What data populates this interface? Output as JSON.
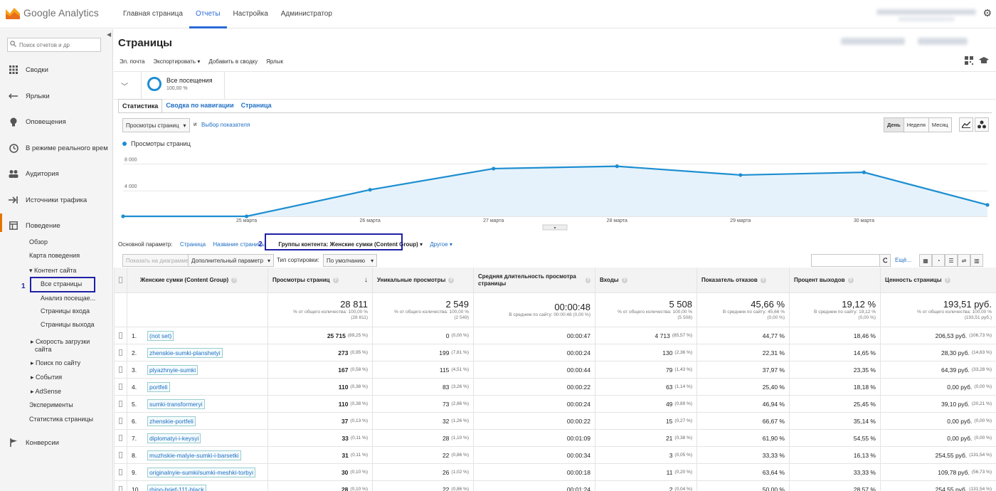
{
  "app": {
    "logo_text": "Google Analytics"
  },
  "topnav": [
    {
      "label": "Главная страница",
      "active": false
    },
    {
      "label": "Отчеты",
      "active": true
    },
    {
      "label": "Настройка",
      "active": false
    },
    {
      "label": "Администратор",
      "active": false
    }
  ],
  "sidebar": {
    "search_placeholder": "Поиск отчетов и др",
    "items": [
      {
        "label": "Сводки",
        "icon": "grid-icon"
      },
      {
        "label": "Ярлыки",
        "icon": "shortcut-icon"
      },
      {
        "label": "Оповещения",
        "icon": "lightbulb-icon"
      },
      {
        "label": "В режиме реального врем",
        "icon": "clock-icon"
      },
      {
        "label": "Аудитория",
        "icon": "people-icon"
      },
      {
        "label": "Источники трафика",
        "icon": "traffic-icon"
      },
      {
        "label": "Поведение",
        "icon": "behavior-icon"
      },
      {
        "label": "Конверсии",
        "icon": "flag-icon"
      }
    ],
    "behavior_sub": {
      "overview": "Обзор",
      "behavior_map": "Карта поведения",
      "content": "▾ Контент сайта",
      "all_pages": "Все страницы",
      "content_drilldown": "Анализ посещае...",
      "landing_pages": "Страницы входа",
      "exit_pages": "Страницы выхода",
      "site_speed": "▸ Скорость загрузки",
      "site_speed_2": "сайта",
      "site_search": "▸ Поиск по сайту",
      "events": "▸ События",
      "adsense": "▸ AdSense",
      "experiments": "Эксперименты",
      "in_page": "Статистика страницы"
    },
    "annotation_1": "1"
  },
  "page": {
    "title": "Страницы",
    "toolbar": {
      "email": "Эл. почта",
      "export": "Экспортировать ▾",
      "add_dashboard": "Добавить в сводку",
      "shortcut": "Ярлык"
    },
    "segment": {
      "name": "Все посещения",
      "pct": "100,00 %"
    },
    "tabs": [
      "Статистика",
      "Сводка по навигации",
      "Страница"
    ],
    "metric_select": "Просмотры страниц",
    "metric_and": "и",
    "metric_compare": "Выбор показателя",
    "periods": [
      "День",
      "Неделя",
      "Месяц"
    ],
    "active_period": "День"
  },
  "chart_data": {
    "type": "area",
    "legend": "Просмотры страниц",
    "color": "#1d8ed1",
    "y_ticks": [
      "8 000",
      "4 000"
    ],
    "ylim": [
      0,
      9000
    ],
    "x_labels": [
      "25 марта",
      "26 марта",
      "27 марта",
      "28 марта",
      "29 марта",
      "30 марта"
    ],
    "points": [
      {
        "x": 0,
        "y": 0
      },
      {
        "x": 1,
        "y": 0
      },
      {
        "x": 2,
        "y": 3950
      },
      {
        "x": 3,
        "y": 7100
      },
      {
        "x": 4,
        "y": 7450
      },
      {
        "x": 5,
        "y": 6150
      },
      {
        "x": 6,
        "y": 6550
      },
      {
        "x": 7,
        "y": 1700
      }
    ]
  },
  "dimensions": {
    "primary_label": "Основной параметр:",
    "page": "Страница",
    "page_title": "Название страницы",
    "content_group": "Группы контента: Женские сумки (Content Group) ▾",
    "other": "Другое ▾",
    "annotation_2": "2"
  },
  "controls": {
    "plot_rows": "Показать на диаграмме",
    "secondary": "Дополнительный параметр",
    "sort_type_label": "Тип сортировки:",
    "sort_default": "По умолчанию",
    "advanced": "Ещё..."
  },
  "table": {
    "headers": [
      "Женские сумки (Content Group)",
      "Просмотры страниц",
      "Уникальные просмотры",
      "Средняя длительность просмотра страницы",
      "Входы",
      "Показатель отказов",
      "Процент выходов",
      "Ценность страницы"
    ],
    "sort_arrow": "↓",
    "totals": [
      {
        "big": "28 811",
        "small1": "% от общего количества: 100,00 %",
        "small2": "(28 811)"
      },
      {
        "big": "2 549",
        "small1": "% от общего количества: 100,00 %",
        "small2": "(2 549)"
      },
      {
        "big": "00:00:48",
        "small1": "В среднем по сайту: 00:00:48 (0,00 %)",
        "small2": ""
      },
      {
        "big": "5 508",
        "small1": "% от общего количества: 100,00 %",
        "small2": "(5 508)"
      },
      {
        "big": "45,66 %",
        "small1": "В среднем по сайту: 45,66 %",
        "small2": "(0,00 %)"
      },
      {
        "big": "19,12 %",
        "small1": "В среднем по сайту: 19,12 %",
        "small2": "(0,00 %)"
      },
      {
        "big": "193,51 руб.",
        "small1": "% от общего количества: 100,00 %",
        "small2": "(193,51 руб.)"
      }
    ],
    "rows": [
      {
        "n": "1.",
        "page": "(not set)",
        "views": "25 715",
        "views_pct": "(89,25 %)",
        "uniq": "0",
        "uniq_pct": "(0,00 %)",
        "dur": "00:00:47",
        "ent": "4 713",
        "ent_pct": "(85,57 %)",
        "bounce": "44,77 %",
        "exit": "18,46 %",
        "value": "206,53 руб.",
        "value_pct": "(106,73 %)"
      },
      {
        "n": "2.",
        "page": "zhenskie-sumki-planshetyi",
        "views": "273",
        "views_pct": "(0,95 %)",
        "uniq": "199",
        "uniq_pct": "(7,81 %)",
        "dur": "00:00:24",
        "ent": "130",
        "ent_pct": "(2,36 %)",
        "bounce": "22,31 %",
        "exit": "14,65 %",
        "value": "28,30 руб.",
        "value_pct": "(14,63 %)"
      },
      {
        "n": "3.",
        "page": "plyazhnyie-sumki",
        "views": "167",
        "views_pct": "(0,58 %)",
        "uniq": "115",
        "uniq_pct": "(4,51 %)",
        "dur": "00:00:44",
        "ent": "79",
        "ent_pct": "(1,43 %)",
        "bounce": "37,97 %",
        "exit": "23,35 %",
        "value": "64,39 руб.",
        "value_pct": "(33,28 %)"
      },
      {
        "n": "4.",
        "page": "portfeli",
        "views": "110",
        "views_pct": "(0,38 %)",
        "uniq": "83",
        "uniq_pct": "(3,26 %)",
        "dur": "00:00:22",
        "ent": "63",
        "ent_pct": "(1,14 %)",
        "bounce": "25,40 %",
        "exit": "18,18 %",
        "value": "0,00 руб.",
        "value_pct": "(0,00 %)"
      },
      {
        "n": "5.",
        "page": "sumki-transformeryi",
        "views": "110",
        "views_pct": "(0,38 %)",
        "uniq": "73",
        "uniq_pct": "(2,86 %)",
        "dur": "00:00:24",
        "ent": "49",
        "ent_pct": "(0,89 %)",
        "bounce": "46,94 %",
        "exit": "25,45 %",
        "value": "39,10 руб.",
        "value_pct": "(20,21 %)"
      },
      {
        "n": "6.",
        "page": "zhenskie-portfeli",
        "views": "37",
        "views_pct": "(0,13 %)",
        "uniq": "32",
        "uniq_pct": "(1,26 %)",
        "dur": "00:00:22",
        "ent": "15",
        "ent_pct": "(0,27 %)",
        "bounce": "66,67 %",
        "exit": "35,14 %",
        "value": "0,00 руб.",
        "value_pct": "(0,00 %)"
      },
      {
        "n": "7.",
        "page": "diplomatyi-i-keysyi",
        "views": "33",
        "views_pct": "(0,11 %)",
        "uniq": "28",
        "uniq_pct": "(1,10 %)",
        "dur": "00:01:09",
        "ent": "21",
        "ent_pct": "(0,38 %)",
        "bounce": "61,90 %",
        "exit": "54,55 %",
        "value": "0,00 руб.",
        "value_pct": "(0,00 %)"
      },
      {
        "n": "8.",
        "page": "muzhskie-malyie-sumki-i-barsetki",
        "views": "31",
        "views_pct": "(0,11 %)",
        "uniq": "22",
        "uniq_pct": "(0,86 %)",
        "dur": "00:00:34",
        "ent": "3",
        "ent_pct": "(0,05 %)",
        "bounce": "33,33 %",
        "exit": "16,13 %",
        "value": "254,55 руб.",
        "value_pct": "(131,54 %)"
      },
      {
        "n": "9.",
        "page": "originalnyie-sumki/sumki-meshki-torbyi",
        "views": "30",
        "views_pct": "(0,10 %)",
        "uniq": "26",
        "uniq_pct": "(1,02 %)",
        "dur": "00:00:18",
        "ent": "11",
        "ent_pct": "(0,20 %)",
        "bounce": "63,64 %",
        "exit": "33,33 %",
        "value": "109,78 руб.",
        "value_pct": "(56,73 %)"
      },
      {
        "n": "10.",
        "page": "rhino-brief-111-black",
        "views": "28",
        "views_pct": "(0,10 %)",
        "uniq": "22",
        "uniq_pct": "(0,86 %)",
        "dur": "00:01:24",
        "ent": "2",
        "ent_pct": "(0,04 %)",
        "bounce": "50,00 %",
        "exit": "28,57 %",
        "value": "254,55 руб.",
        "value_pct": "(131,54 %)"
      }
    ]
  }
}
